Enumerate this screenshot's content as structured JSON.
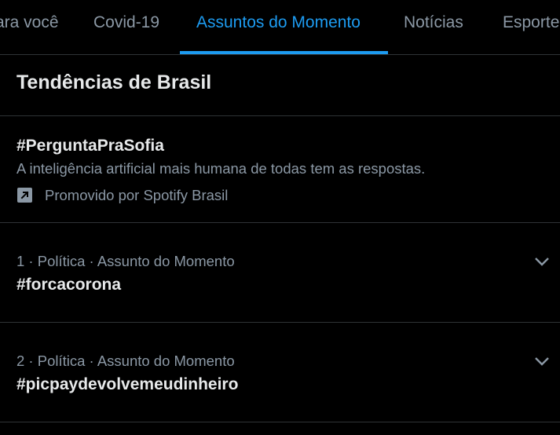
{
  "tabs": [
    {
      "label": "ara você",
      "active": false
    },
    {
      "label": "Covid-19",
      "active": false
    },
    {
      "label": "Assuntos do Momento",
      "active": true
    },
    {
      "label": "Notícias",
      "active": false
    },
    {
      "label": "Esporte",
      "active": false
    }
  ],
  "section": {
    "title": "Tendências de Brasil"
  },
  "promoted": {
    "hashtag": "#PerguntaPraSofia",
    "description": "A inteligência artificial mais humana de todas tem as respostas.",
    "promoted_by": "Promovido por Spotify Brasil",
    "icon": "promoted-arrow-icon"
  },
  "trends": [
    {
      "meta": "1 · Política · Assunto do Momento",
      "name": "#forcacorona"
    },
    {
      "meta": "2 · Política · Assunto do Momento",
      "name": "#picpaydevolvemeudinheiro"
    }
  ],
  "colors": {
    "background": "#000000",
    "accent": "#1d9bf0",
    "primary_text": "#e7e9ea",
    "secondary_text": "#8b98a5",
    "divider": "#2f3336"
  }
}
